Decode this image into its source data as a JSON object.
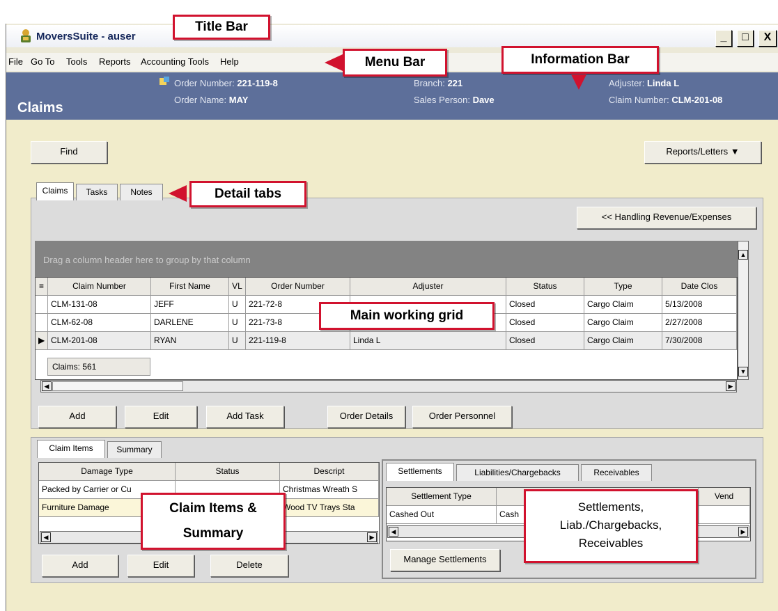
{
  "window": {
    "title": "MoversSuite - auser",
    "min_label": "_",
    "max_label": "□",
    "close_label": "X"
  },
  "menu": [
    "File",
    "Go To",
    "Tools",
    "Reports",
    "Accounting Tools",
    "Help"
  ],
  "info": {
    "module": "Claims",
    "order_number_label": "Order Number:",
    "order_number": "221-119-8",
    "order_name_label": "Order Name:",
    "order_name": "MAY",
    "branch_label": "Branch:",
    "branch": "221",
    "sales_label": "Sales Person:",
    "sales": "Dave",
    "adjuster_label": "Adjuster:",
    "adjuster": "Linda L",
    "claim_label": "Claim Number:",
    "claim": "CLM-201-08"
  },
  "buttons": {
    "find": "Find",
    "reports": "Reports/Letters ▼",
    "handling": "<< Handling Revenue/Expenses",
    "add": "Add",
    "edit": "Edit",
    "add_task": "Add Task",
    "order_details": "Order Details",
    "order_personnel": "Order Personnel",
    "items_add": "Add",
    "items_edit": "Edit",
    "items_delete": "Delete",
    "manage_settlements": "Manage Settlements"
  },
  "detail_tabs": [
    "Claims",
    "Tasks",
    "Notes"
  ],
  "grid": {
    "group_hint": "Drag a column header here to group by that column",
    "columns": [
      "Claim Number",
      "First Name",
      "VL",
      "Order Number",
      "Adjuster",
      "Status",
      "Type",
      "Date Clos"
    ],
    "rows": [
      [
        "CLM-131-08",
        "JEFF",
        "U",
        "221-72-8",
        "",
        "Closed",
        "Cargo Claim",
        "5/13/2008"
      ],
      [
        "CLM-62-08",
        "DARLENE",
        "U",
        "221-73-8",
        "",
        "Closed",
        "Cargo Claim",
        "2/27/2008"
      ],
      [
        "CLM-201-08",
        "RYAN",
        "U",
        "221-119-8",
        "Linda L",
        "Closed",
        "Cargo Claim",
        "7/30/2008"
      ]
    ],
    "count": "Claims: 561"
  },
  "item_tabs": [
    "Claim Items",
    "Summary"
  ],
  "items_grid": {
    "columns": [
      "Damage Type",
      "Status",
      "Descript"
    ],
    "rows": [
      [
        "Packed by Carrier or Cu",
        "",
        "Christmas Wreath S"
      ],
      [
        "Furniture Damage",
        "",
        "Wood TV Trays Sta"
      ]
    ]
  },
  "settle_tabs": [
    "Settlements",
    "Liabilities/Chargebacks",
    "Receivables"
  ],
  "settle_grid": {
    "columns": [
      "Settlement Type",
      "",
      "Vend"
    ],
    "rows": [
      [
        "Cashed Out",
        "Cash",
        ""
      ]
    ]
  },
  "callouts": {
    "title_bar": "Title Bar",
    "menu_bar": "Menu Bar",
    "info_bar": "Information Bar",
    "detail_tabs": "Detail tabs",
    "main_grid": "Main working grid",
    "claim_items": [
      "Claim Items &",
      "Summary"
    ],
    "settlements": [
      "Settlements,",
      "Liab./Chargebacks,",
      "Receivables"
    ]
  },
  "colors": {
    "info_bar": "#5d6f9a",
    "callout_border": "#d1122e",
    "content_bg": "#f1eccb"
  }
}
